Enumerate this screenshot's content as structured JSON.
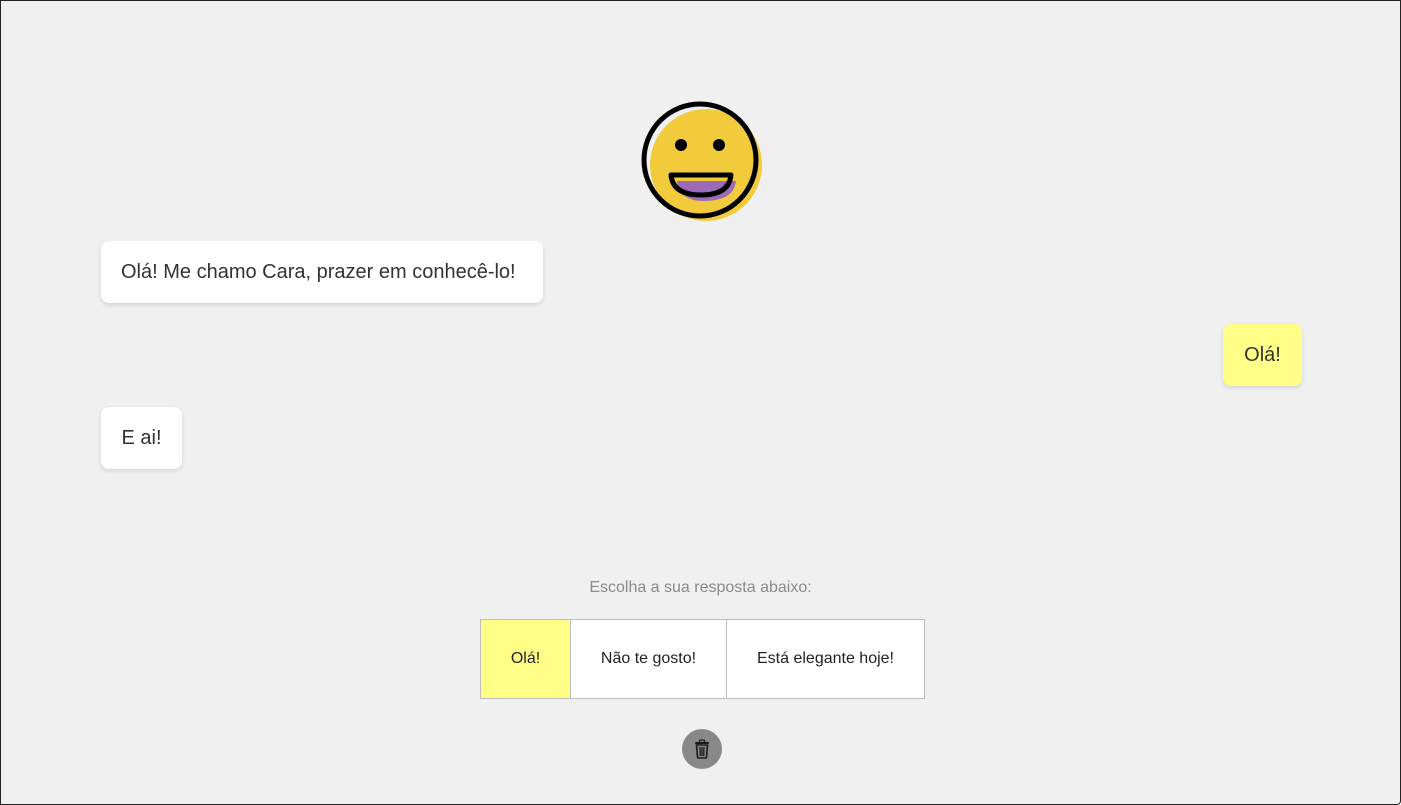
{
  "colors": {
    "background": "#f0f0f0",
    "bot_bubble": "#ffffff",
    "user_bubble": "#ffff88",
    "avatar_face": "#f2cb3c",
    "avatar_mouth": "#9b6bb8",
    "delete_button": "#888888"
  },
  "avatar": {
    "icon": "grinning-face-icon"
  },
  "messages": [
    {
      "sender": "bot",
      "text": "Olá! Me chamo Cara, prazer em conhecê-lo!"
    },
    {
      "sender": "user",
      "text": "Olá!"
    },
    {
      "sender": "bot",
      "text": "E ai!"
    }
  ],
  "reply": {
    "prompt": "Escolha a sua resposta abaixo:",
    "options": [
      {
        "label": "Olá!",
        "selected": true
      },
      {
        "label": "Não te gosto!",
        "selected": false
      },
      {
        "label": "Está elegante hoje!",
        "selected": false
      }
    ]
  },
  "actions": {
    "delete_icon": "trash-icon"
  }
}
